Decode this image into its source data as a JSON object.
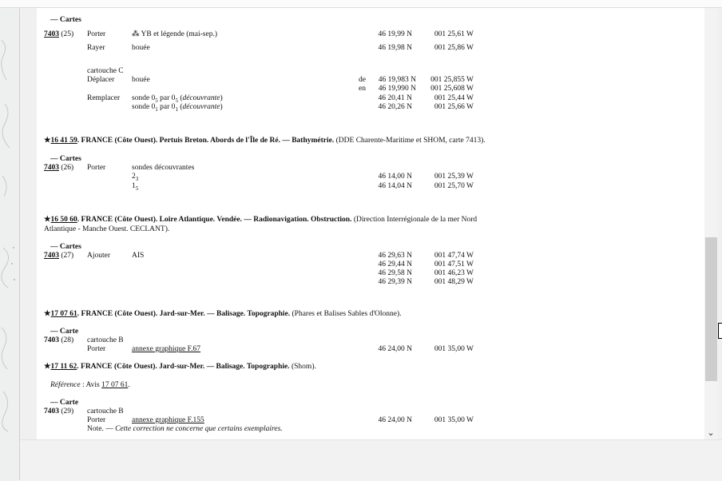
{
  "s1": {
    "header": "— Cartes",
    "chart": "7403",
    "num": "(25)",
    "rows": [
      {
        "action": "Porter",
        "obj": "⁂ YB et légende (mai-sep.)",
        "lat": "46 19,99 N",
        "lon": "001 25,61 W"
      },
      {
        "action": "Rayer",
        "obj": "bouée",
        "lat": "46 19,98 N",
        "lon": "001 25,86 W"
      }
    ],
    "cartouche": "cartouche C",
    "move": {
      "action": "Déplacer",
      "obj": "bouée",
      "from": "de",
      "to": "en",
      "lat1": "46 19,983 N",
      "lon1": "001 25,855 W",
      "lat2": "46 19,990 N",
      "lon2": "001 25,608 W"
    },
    "replace": [
      {
        "action": "Remplacer",
        "pre": "sonde 0",
        "s1": "5",
        "mid": " par 0",
        "s2": "5",
        "post": " (",
        "em": "découvrante",
        "end": ")",
        "lat": "46 20,41 N",
        "lon": "001 25,44 W"
      },
      {
        "action": "",
        "pre": "sonde 0",
        "s1": "1",
        "mid": " par 0",
        "s2": "1",
        "post": " (",
        "em": "découvrante",
        "end": ")",
        "lat": "46 20,26 N",
        "lon": "001 25,66 W"
      }
    ]
  },
  "n2": {
    "star": "★",
    "ref": "16 41 59",
    "title": ". FRANCE (Côte Ouest). Pertuis Breton. Abords de l'Île de Ré. — Bathymétrie.",
    "source": " (DDE Charente-Maritime et SHOM, carte 7413).",
    "header": "— Cartes",
    "chart": "7403",
    "num": "(26)",
    "action": "Porter",
    "obj": "sondes découvrantes",
    "rows": [
      {
        "v": "2",
        "s": "3",
        "lat": "46 14,00 N",
        "lon": "001 25,39 W"
      },
      {
        "v": "1",
        "s": "5",
        "lat": "46 14,04 N",
        "lon": "001 25,70 W"
      }
    ]
  },
  "n3": {
    "star": "★",
    "ref": "16 50 60",
    "title": ". FRANCE (Côte Ouest). Loire Atlantique. Vendée. — Radionavigation. Obstruction.",
    "source1": " (Direction Interrégionale de la mer Nord",
    "source2": "Atlantique - Manche Ouest. CECLANT).",
    "header": "— Cartes",
    "chart": "7403",
    "num": "(27)",
    "action": "Ajouter",
    "obj": "AIS",
    "rows": [
      {
        "lat": "46 29,63 N",
        "lon": "001 47,74 W"
      },
      {
        "lat": "46 29,44 N",
        "lon": "001 47,51 W"
      },
      {
        "lat": "46 29,58 N",
        "lon": "001 46,23 W"
      },
      {
        "lat": "46 29,39 N",
        "lon": "001 48,29 W"
      }
    ]
  },
  "n4": {
    "star": "★",
    "ref": "17 07 61",
    "title": ". FRANCE (Côte Ouest). Jard-sur-Mer. — Balisage. Topographie.",
    "source": " (Phares et Balises Sables d'Olonne).",
    "header": "— Carte",
    "chart": "7403",
    "num": "(28)",
    "cartouche": "cartouche B",
    "action": "Porter",
    "obj": "annexe graphique F.67",
    "lat": "46 24,00 N",
    "lon": "001 35,00 W"
  },
  "n5": {
    "star": "★",
    "ref": "17 11 62",
    "title": ". FRANCE (Côte Ouest). Jard-sur-Mer. — Balisage. Topographie.",
    "source": " (Shom).",
    "refLabel": "Référence",
    "refSep": " : Avis ",
    "refLink": "17 07 61",
    "refEnd": ".",
    "header": "— Carte",
    "chart": "7403",
    "num": "(29)",
    "cartouche": "cartouche B",
    "action": "Porter",
    "obj": "annexe graphique F.155",
    "lat": "46 24,00 N",
    "lon": "001 35,00 W",
    "noteLabel": "Note. — ",
    "note": "Cette correction ne concerne que certains exemplaires."
  }
}
